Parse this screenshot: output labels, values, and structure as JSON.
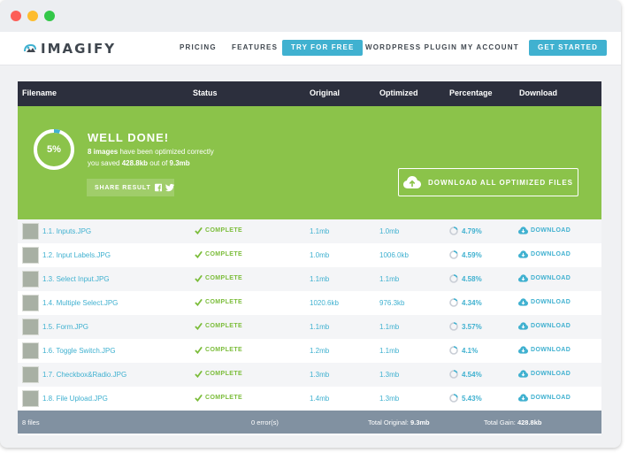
{
  "window": {
    "controls": [
      "close",
      "minimize",
      "maximize"
    ]
  },
  "nav": {
    "logo": "IMAGIFY",
    "links": [
      "PRICING",
      "FEATURES",
      "WORDPRESS PLUGIN",
      "MY ACCOUNT"
    ],
    "try_label": "TRY FOR FREE",
    "started_label": "GET STARTED"
  },
  "table": {
    "headers": [
      "Filename",
      "Status",
      "Original",
      "Optimized",
      "Percentage",
      "Download"
    ]
  },
  "banner": {
    "progress_label": "5%",
    "progress_value": 0.05,
    "title": "WELL DONE!",
    "count_text": "8 images",
    "line1_rest": " have been optimized correctly",
    "line2_prefix": "you saved ",
    "saved": "428.8kb",
    "line2_mid": " out of ",
    "total": "9.3mb",
    "share_label": "SHARE RESULT",
    "download_all_label": "DOWNLOAD ALL OPTIMIZED FILES"
  },
  "rows": [
    {
      "filename": "1.1. Inputs.JPG",
      "status": "COMPLETE",
      "original": "1.1mb",
      "optimized": "1.0mb",
      "percentage": "4.79%",
      "download": "DOWNLOAD"
    },
    {
      "filename": "1.2. Input Labels.JPG",
      "status": "COMPLETE",
      "original": "1.0mb",
      "optimized": "1006.0kb",
      "percentage": "4.59%",
      "download": "DOWNLOAD"
    },
    {
      "filename": "1.3. Select Input.JPG",
      "status": "COMPLETE",
      "original": "1.1mb",
      "optimized": "1.1mb",
      "percentage": "4.58%",
      "download": "DOWNLOAD"
    },
    {
      "filename": "1.4. Multiple Select.JPG",
      "status": "COMPLETE",
      "original": "1020.6kb",
      "optimized": "976.3kb",
      "percentage": "4.34%",
      "download": "DOWNLOAD"
    },
    {
      "filename": "1.5. Form.JPG",
      "status": "COMPLETE",
      "original": "1.1mb",
      "optimized": "1.1mb",
      "percentage": "3.57%",
      "download": "DOWNLOAD"
    },
    {
      "filename": "1.6. Toggle Switch.JPG",
      "status": "COMPLETE",
      "original": "1.2mb",
      "optimized": "1.1mb",
      "percentage": "4.1%",
      "download": "DOWNLOAD"
    },
    {
      "filename": "1.7. Checkbox&Radio.JPG",
      "status": "COMPLETE",
      "original": "1.3mb",
      "optimized": "1.3mb",
      "percentage": "4.54%",
      "download": "DOWNLOAD"
    },
    {
      "filename": "1.8. File Upload.JPG",
      "status": "COMPLETE",
      "original": "1.4mb",
      "optimized": "1.3mb",
      "percentage": "5.43%",
      "download": "DOWNLOAD"
    }
  ],
  "footer": {
    "files": "8 files",
    "errors": "0 error(s)",
    "total_original_label": "Total Original: ",
    "total_original": "9.3mb",
    "total_gain_label": "Total Gain: ",
    "total_gain": "428.8kb"
  },
  "colors": {
    "accent": "#40b1d0",
    "success": "#8bc34a",
    "header_dark": "#2c2f3d",
    "footer_slate": "#8191a1"
  },
  "icons": [
    "imagify-logo-icon",
    "facebook-icon",
    "twitter-icon",
    "cloud-upload-icon",
    "check-icon",
    "progress-ring-icon",
    "cloud-download-icon"
  ]
}
